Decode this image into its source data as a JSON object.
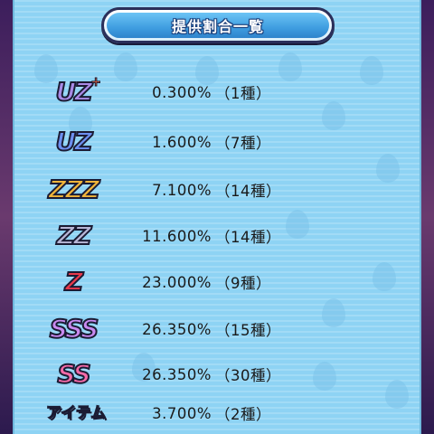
{
  "title": "提供割合一覧",
  "rows": [
    {
      "rank": "UZ",
      "rank_plus": "+",
      "rate": "0.300%",
      "count": "（1種）",
      "color": "#a98ae6"
    },
    {
      "rank": "UZ",
      "rank_plus": "",
      "rate": "1.600%",
      "count": "（7種）",
      "color": "#6d8ff0"
    },
    {
      "rank": "ZZZ",
      "rank_plus": "",
      "rate": "7.100%",
      "count": "（14種）",
      "color": "#f2b53a"
    },
    {
      "rank": "ZZ",
      "rank_plus": "",
      "rate": "11.600%",
      "count": "（14種）",
      "color": "#b8b6d6"
    },
    {
      "rank": "Z",
      "rank_plus": "",
      "rate": "23.000%",
      "count": "（9種）",
      "color": "#e8394b"
    },
    {
      "rank": "SSS",
      "rank_plus": "",
      "rate": "26.350%",
      "count": "（15種）",
      "color": "#c98af0"
    },
    {
      "rank": "SS",
      "rank_plus": "",
      "rate": "26.350%",
      "count": "（30種）",
      "color": "#f56aa8"
    },
    {
      "rank": "アイテム",
      "rank_plus": "",
      "rate": "3.700%",
      "count": "（2種）",
      "color": "#ffffff"
    }
  ]
}
